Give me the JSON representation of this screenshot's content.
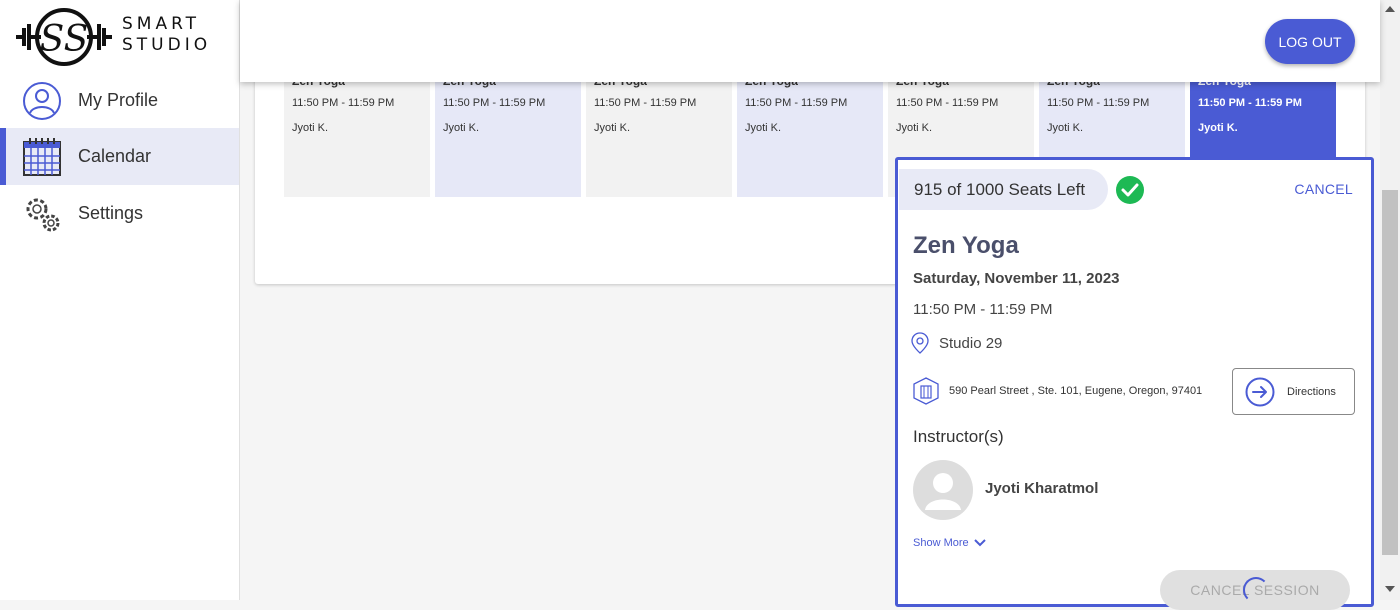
{
  "brand": {
    "line1": "SMART",
    "line2": "STUDIO"
  },
  "sidebar": {
    "items": [
      {
        "label": "My Profile",
        "icon": "user-circle-icon"
      },
      {
        "label": "Calendar",
        "icon": "calendar-icon"
      },
      {
        "label": "Settings",
        "icon": "gear-icon"
      }
    ],
    "active": "Calendar"
  },
  "header": {
    "logout_label": "LOG OUT"
  },
  "sessions": [
    {
      "title": "Zen Yoga",
      "time": "11:50 PM - 11:59 PM",
      "instructor": "Jyoti K.",
      "style": "grey"
    },
    {
      "title": "Zen Yoga",
      "time": "11:50 PM - 11:59 PM",
      "instructor": "Jyoti K.",
      "style": "blue"
    },
    {
      "title": "Zen Yoga",
      "time": "11:50 PM - 11:59 PM",
      "instructor": "Jyoti K.",
      "style": "grey"
    },
    {
      "title": "Zen Yoga",
      "time": "11:50 PM - 11:59 PM",
      "instructor": "Jyoti K.",
      "style": "blue"
    },
    {
      "title": "Zen Yoga",
      "time": "11:50 PM - 11:59 PM",
      "instructor": "Jyoti K.",
      "style": "grey"
    },
    {
      "title": "Zen Yoga",
      "time": "11:50 PM - 11:59 PM",
      "instructor": "Jyoti K.",
      "style": "blue"
    },
    {
      "title": "Zen Yoga",
      "time": "11:50 PM - 11:59 PM",
      "instructor": "Jyoti K.",
      "style": "sel"
    }
  ],
  "popup": {
    "seats": "915 of 1000 Seats Left",
    "cancel_label": "CANCEL",
    "title": "Zen Yoga",
    "date": "Saturday, November 11, 2023",
    "time": "11:50 PM - 11:59 PM",
    "studio": "Studio 29",
    "address": "590 Pearl Street , Ste. 101, Eugene, Oregon, 97401",
    "directions_label": "Directions",
    "instructors_heading": "Instructor(s)",
    "instructor_name": "Jyoti Kharatmol",
    "show_more": "Show More",
    "cancel_session_label": "CANCEL SESSION"
  },
  "colors": {
    "accent": "#4a5bd4",
    "success": "#1db954",
    "selected_bg": "#e8eaf6"
  }
}
